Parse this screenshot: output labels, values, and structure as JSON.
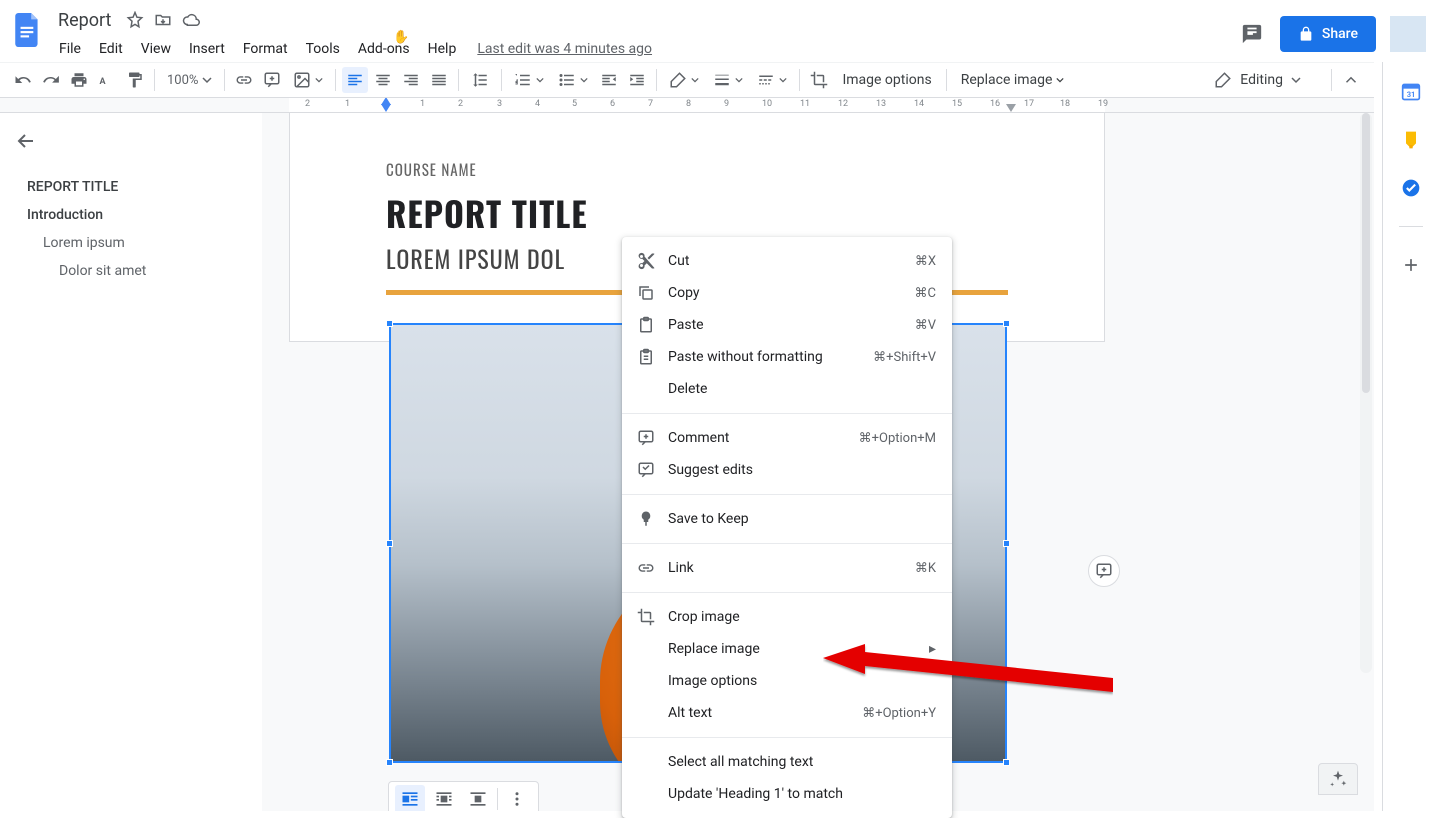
{
  "doc": {
    "title": "Report",
    "last_edit": "Last edit was 4 minutes ago"
  },
  "menus": [
    "File",
    "Edit",
    "View",
    "Insert",
    "Format",
    "Tools",
    "Add-ons",
    "Help"
  ],
  "share": "Share",
  "toolbar": {
    "zoom": "100%",
    "image_options": "Image options",
    "replace_image": "Replace image",
    "editing": "Editing"
  },
  "ruler": {
    "nums": [
      "2",
      "1",
      "1",
      "2",
      "3",
      "4",
      "5",
      "6",
      "7",
      "8",
      "9",
      "10",
      "11",
      "12",
      "13",
      "14",
      "15",
      "16",
      "17",
      "18",
      "19"
    ]
  },
  "outline": {
    "items": [
      {
        "label": "REPORT TITLE",
        "lvl": 1
      },
      {
        "label": "Introduction",
        "lvl": 2
      },
      {
        "label": "Lorem ipsum",
        "lvl": 3
      },
      {
        "label": "Dolor sit amet",
        "lvl": 4
      }
    ]
  },
  "page": {
    "course": "COURSE NAME",
    "title": "REPORT TITLE",
    "subtitle": "LOREM IPSUM DOL"
  },
  "ctx": {
    "rows": [
      {
        "icon": "cut",
        "label": "Cut",
        "sc": "⌘X"
      },
      {
        "icon": "copy",
        "label": "Copy",
        "sc": "⌘C"
      },
      {
        "icon": "paste",
        "label": "Paste",
        "sc": "⌘V"
      },
      {
        "icon": "paste-plain",
        "label": "Paste without formatting",
        "sc": "⌘+Shift+V"
      },
      {
        "icon": "",
        "label": "Delete",
        "sc": ""
      },
      {
        "sep": true
      },
      {
        "icon": "comment",
        "label": "Comment",
        "sc": "⌘+Option+M"
      },
      {
        "icon": "suggest",
        "label": "Suggest edits",
        "sc": ""
      },
      {
        "sep": true
      },
      {
        "icon": "keep",
        "label": "Save to Keep",
        "sc": ""
      },
      {
        "sep": true
      },
      {
        "icon": "link",
        "label": "Link",
        "sc": "⌘K"
      },
      {
        "sep": true
      },
      {
        "icon": "crop",
        "label": "Crop image",
        "sc": ""
      },
      {
        "icon": "",
        "label": "Replace image",
        "sc": "",
        "sub": true
      },
      {
        "icon": "",
        "label": "Image options",
        "sc": ""
      },
      {
        "icon": "",
        "label": "Alt text",
        "sc": "⌘+Option+Y"
      },
      {
        "sep": true
      },
      {
        "icon": "",
        "label": "Select all matching text",
        "sc": ""
      },
      {
        "icon": "",
        "label": "Update 'Heading 1' to match",
        "sc": ""
      }
    ]
  }
}
